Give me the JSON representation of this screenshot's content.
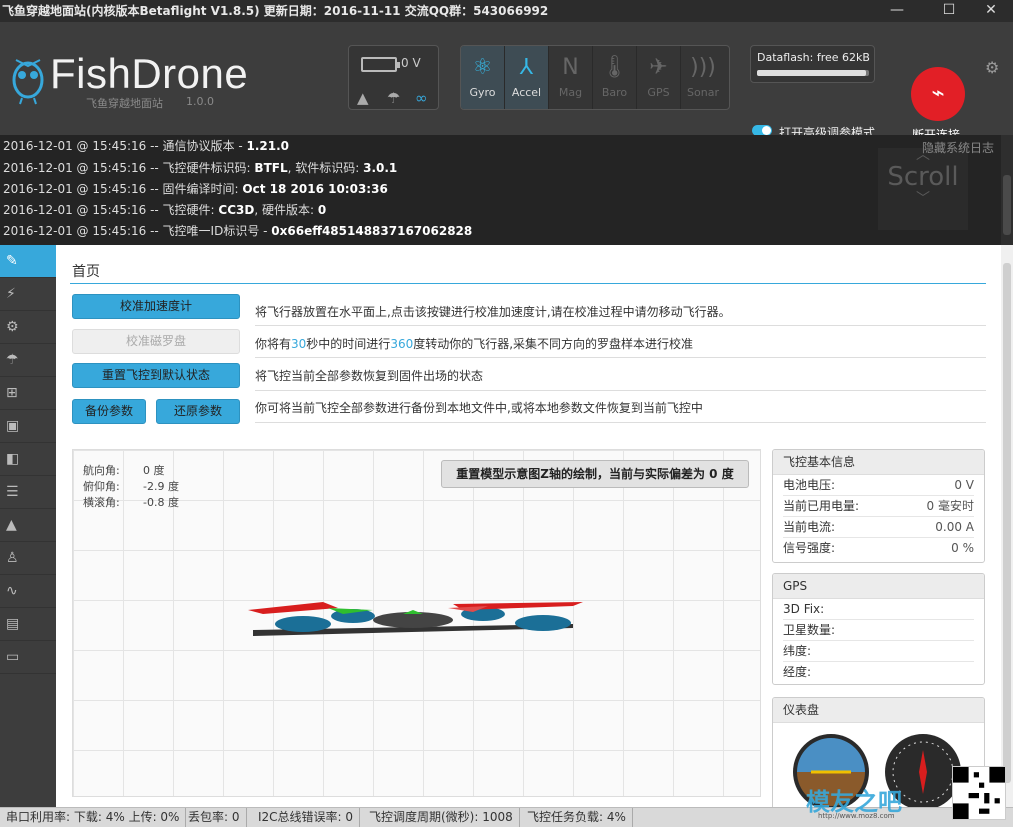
{
  "window": {
    "title": "飞鱼穿越地面站(内核版本Betaflight V1.8.5)  更新日期：2016-11-11  交流QQ群：543066992",
    "minimize": "—",
    "maximize": "☐",
    "close": "✕"
  },
  "header": {
    "logo": "FishDrone",
    "subtitle": "飞鱼穿越地面站",
    "version": "1.0.0",
    "battery_voltage": "0 V",
    "sensors": [
      {
        "label": "Gyro",
        "icon": "gyro-icon",
        "active": true
      },
      {
        "label": "Accel",
        "icon": "accel-icon",
        "active": true
      },
      {
        "label": "Mag",
        "icon": "mag-icon",
        "active": false
      },
      {
        "label": "Baro",
        "icon": "baro-icon",
        "active": false
      },
      {
        "label": "GPS",
        "icon": "gps-icon",
        "active": false
      },
      {
        "label": "Sonar",
        "icon": "sonar-icon",
        "active": false
      }
    ],
    "dataflash": "Dataflash: free 62kB",
    "dataflash_free_fraction": 0.97,
    "advanced_mode_label": "打开高级调参模式",
    "advanced_mode_on": true,
    "connect_label": "断开连接",
    "accent": "#37a8db",
    "connect_color": "#e21f26"
  },
  "log": {
    "hide_label": "隐藏系统日志",
    "scroll_label": "Scroll",
    "lines": [
      {
        "prefix": "2016-12-01 @ 15:45:16 -- 通信协议版本 - ",
        "bold": "1.21.0"
      },
      {
        "prefix": "2016-12-01 @ 15:45:16 -- 飞控硬件标识码: ",
        "bold": "BTFL",
        "suffix": ", 软件标识码: ",
        "bold2": "3.0.1"
      },
      {
        "prefix": "2016-12-01 @ 15:45:16 -- 固件编译时间: ",
        "bold": "Oct 18 2016 10:03:36"
      },
      {
        "prefix": "2016-12-01 @ 15:45:16 -- 飞控硬件: ",
        "bold": "CC3D",
        "suffix": ", 硬件版本: ",
        "bold2": "0"
      },
      {
        "prefix": "2016-12-01 @ 15:45:16 -- 飞控唯一ID标识号 - ",
        "bold": "0x66eff485148837167062828"
      }
    ]
  },
  "sidebar": {
    "items": [
      {
        "icon": "wrench-icon",
        "glyph": "✎"
      },
      {
        "icon": "plug-icon",
        "glyph": "⚡"
      },
      {
        "icon": "gear-icon",
        "glyph": "⚙"
      },
      {
        "icon": "parachute-icon",
        "glyph": "☂"
      },
      {
        "icon": "network-icon",
        "glyph": "⊞"
      },
      {
        "icon": "robot-icon",
        "glyph": "▣"
      },
      {
        "icon": "toggles-icon",
        "glyph": "◧"
      },
      {
        "icon": "sliders-icon",
        "glyph": "☰"
      },
      {
        "icon": "hat-icon",
        "glyph": "▲"
      },
      {
        "icon": "flask-icon",
        "glyph": "♙"
      },
      {
        "icon": "pulse-icon",
        "glyph": "∿"
      },
      {
        "icon": "drive-icon",
        "glyph": "▤"
      },
      {
        "icon": "window-icon",
        "glyph": "▭"
      }
    ]
  },
  "main": {
    "title": "首页",
    "actions": {
      "calibrate_accel": "校准加速度计",
      "calibrate_accel_desc": "将飞行器放置在水平面上,点击该按键进行校准加速度计,请在校准过程中请勿移动飞行器。",
      "calibrate_mag": "校准磁罗盘",
      "calibrate_mag_desc_a": "你将有",
      "calibrate_mag_desc_b": "30",
      "calibrate_mag_desc_c": "秒中的时间进行",
      "calibrate_mag_desc_d": "360",
      "calibrate_mag_desc_e": "度转动你的飞行器,采集不同方向的罗盘样本进行校准",
      "reset_defaults": "重置飞控到默认状态",
      "reset_defaults_desc": "将飞控当前全部参数恢复到固件出场的状态",
      "backup": "备份参数",
      "restore": "还原参数",
      "backup_desc": "你可将当前飞控全部参数进行备份到本地文件中,或将本地参数文件恢复到当前飞控中"
    },
    "attitude": {
      "heading_label": "航向角:",
      "heading_value": "0 度",
      "pitch_label": "俯仰角:",
      "pitch_value": "-2.9 度",
      "roll_label": "横滚角:",
      "roll_value": "-0.8 度"
    },
    "reset_z_button": "重置模型示意图Z轴的绘制，当前与实际偏差为 0 度",
    "info": {
      "title": "飞控基本信息",
      "rows": [
        {
          "label": "电池电压:",
          "value": "0 V"
        },
        {
          "label": "当前已用电量:",
          "value": "0 毫安时"
        },
        {
          "label": "当前电流:",
          "value": "0.00 A"
        },
        {
          "label": "信号强度:",
          "value": "0 %"
        }
      ]
    },
    "gps": {
      "title": "GPS",
      "rows": [
        {
          "label": "3D Fix:",
          "value": ""
        },
        {
          "label": "卫星数量:",
          "value": ""
        },
        {
          "label": "纬度:",
          "value": ""
        },
        {
          "label": "经度:",
          "value": ""
        }
      ]
    },
    "dashboard": {
      "title": "仪表盘"
    }
  },
  "statusbar": {
    "port_usage": "串口利用率: 下载: 4% 上传: 0%",
    "packet_loss": "丢包率: 0",
    "i2c_errors": "I2C总线错误率: 0",
    "cycle_time": "飞控调度周期(微秒): 1008",
    "cpu_load": "飞控任务负载: 4%"
  },
  "watermark": {
    "brand": "模友之吧",
    "url": "http://www.moz8.com"
  }
}
